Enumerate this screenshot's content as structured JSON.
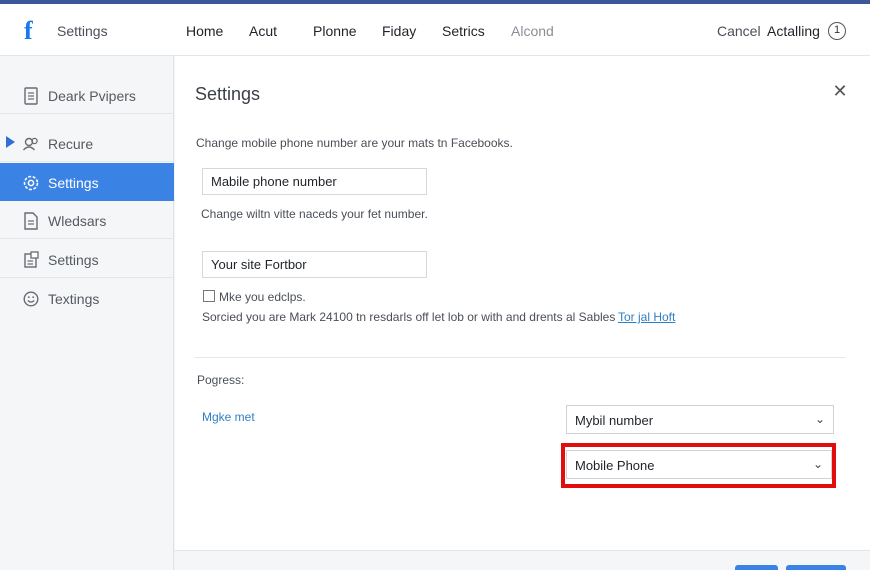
{
  "header": {
    "logo_letter": "f",
    "app_title": "Settings",
    "nav": [
      "Home",
      "Acut",
      "Plonne",
      "Fiday",
      "Setrics",
      "Alcond"
    ],
    "cancel_label": "Cancel",
    "action_label": "Actalling",
    "info_glyph": "1"
  },
  "sidebar": {
    "items": [
      {
        "label": "Deark Pvipers",
        "icon": "document-icon"
      },
      {
        "label": "Recure",
        "icon": "users-icon"
      },
      {
        "label": "Settings",
        "icon": "gear-icon"
      },
      {
        "label": "Wledsars",
        "icon": "page-icon"
      },
      {
        "label": "Settings",
        "icon": "settings-page-icon"
      },
      {
        "label": "Textings",
        "icon": "smiley-icon"
      }
    ],
    "active_index": 2
  },
  "main": {
    "title": "Settings",
    "description": "Change mobile phone number are your mats tn Facebooks.",
    "phone_input_value": "Mabile phone number",
    "help_text": "Change wiltn vitte naceds your fet number.",
    "site_input_value": "Your site Fortbor",
    "checkbox_label": "Mke you edclps.",
    "info_line": "Sorcied you are Mark 24100 tn resdarls off let lob or with and drents al Sables",
    "info_link": "Tor jal Hoft",
    "progress_label": "Pogress:",
    "make_link": "Mgke met",
    "select_1_value": "Mybil number",
    "select_2_value": "Mobile Phone"
  },
  "colors": {
    "brand": "#1877f2",
    "accent": "#3a82e4",
    "highlight": "#e10e0e"
  }
}
